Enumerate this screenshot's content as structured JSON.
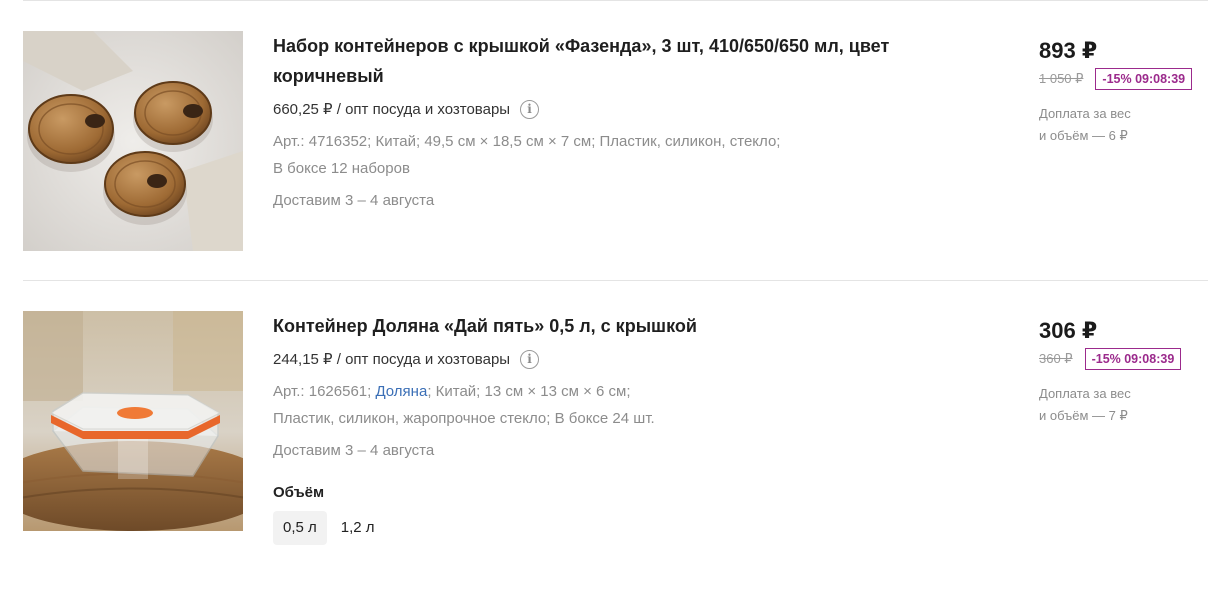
{
  "products": [
    {
      "image_icon": "brown-glass-containers-photo",
      "title_line1": "Набор контейнеров с крышкой «Фазенда», 3 шт, 410/650/650 мл, цвет",
      "title_line2": "коричневый",
      "wholesale_price": "660,25 ₽ / опт посуда и хозтовары",
      "info_icon_glyph": "i",
      "specs_line1": "Арт.: 4716352; Китай; 49,5 см × 18,5 см × 7 см; Пластик, силикон, стекло;",
      "specs_line2": "В боксе 12 наборов",
      "delivery": "Доставим 3 – 4 августа",
      "price": "893 ₽",
      "old_price": "1 050 ₽",
      "discount_badge": "-15% 09:08:39",
      "extra_line1": "Доплата за вес",
      "extra_line2": "и объём — 6 ₽"
    },
    {
      "image_icon": "square-glass-container-photo",
      "title_line1": "Контейнер Доляна «Дай пять» 0,5 л, с крышкой",
      "wholesale_price": "244,15 ₽ / опт посуда и хозтовары",
      "info_icon_glyph": "i",
      "specs_art": "Арт.: 1626561;",
      "specs_brand": "Доляна",
      "specs_rest": "; Китай; 13 см × 13 см × 6 см;",
      "specs_line2": "Пластик, силикон, жаропрочное стекло; В боксе 24 шт.",
      "delivery": "Доставим 3 – 4 августа",
      "variant_label": "Объём",
      "variants": [
        "0,5 л",
        "1,2 л"
      ],
      "selected_variant": "0,5 л",
      "price": "306 ₽",
      "old_price": "360 ₽",
      "discount_badge": "-15% 09:08:39",
      "extra_line1": "Доплата за вес",
      "extra_line2": "и объём — 7 ₽"
    }
  ],
  "colors": {
    "discount": "#9b2a8c",
    "brand_link": "#3b6fb6",
    "muted_text": "#8c8c8c"
  }
}
